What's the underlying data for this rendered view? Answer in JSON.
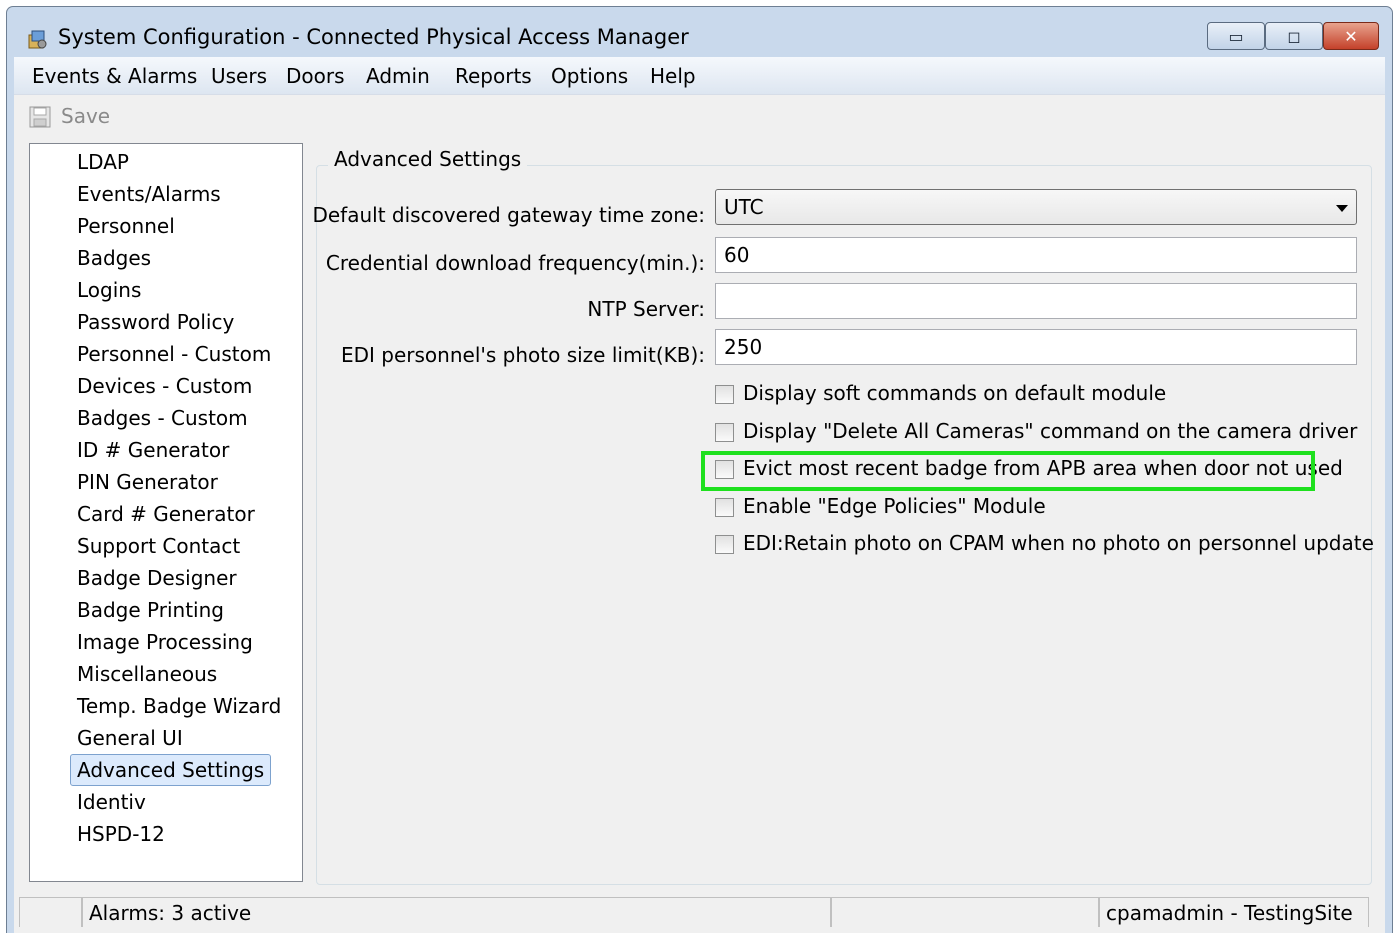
{
  "window": {
    "title": "System Configuration - Connected Physical Access Manager",
    "minimize": "▭",
    "maximize": "◻",
    "close": "✕"
  },
  "menu": [
    "Events & Alarms",
    "Users",
    "Doors",
    "Admin",
    "Reports",
    "Options",
    "Help"
  ],
  "toolbar": {
    "save_label": "Save",
    "save_icon": "floppy-disk-icon"
  },
  "sidebar": {
    "selected": "Advanced Settings",
    "items": [
      "LDAP",
      "Events/Alarms",
      "Personnel",
      "Badges",
      "Logins",
      "Password Policy",
      "Personnel - Custom",
      "Devices - Custom",
      "Badges - Custom",
      "ID # Generator",
      "PIN Generator",
      "Card # Generator",
      "Support Contact",
      "Badge Designer",
      "Badge Printing",
      "Image Processing",
      "Miscellaneous",
      "Temp. Badge Wizard",
      "General UI",
      "Advanced Settings",
      "Identiv",
      "HSPD-12"
    ]
  },
  "advanced": {
    "group_title": "Advanced Settings",
    "fields": [
      {
        "label": "Default discovered gateway time zone:",
        "value": "UTC",
        "type": "select"
      },
      {
        "label": "Credential download frequency(min.):",
        "value": "60",
        "type": "text"
      },
      {
        "label": "NTP Server:",
        "value": "",
        "type": "text"
      },
      {
        "label": "EDI personnel's photo size limit(KB):",
        "value": "250",
        "type": "text"
      }
    ],
    "checkboxes": [
      {
        "label": "Display soft commands on default module",
        "checked": false
      },
      {
        "label": "Display \"Delete All Cameras\" command on the camera driver",
        "checked": false
      },
      {
        "label": "Evict most recent badge from APB area when door not used",
        "checked": false
      },
      {
        "label": "Enable \"Edge Policies\" Module",
        "checked": false
      },
      {
        "label": "EDI:Retain photo on CPAM when no photo on personnel update",
        "checked": false
      }
    ]
  },
  "status": {
    "alarms": "Alarms: 3 active",
    "middle": "",
    "user": "cpamadmin - TestingSite"
  },
  "colors": {
    "highlight": "#1ee01e",
    "selection": "#dceafc"
  }
}
